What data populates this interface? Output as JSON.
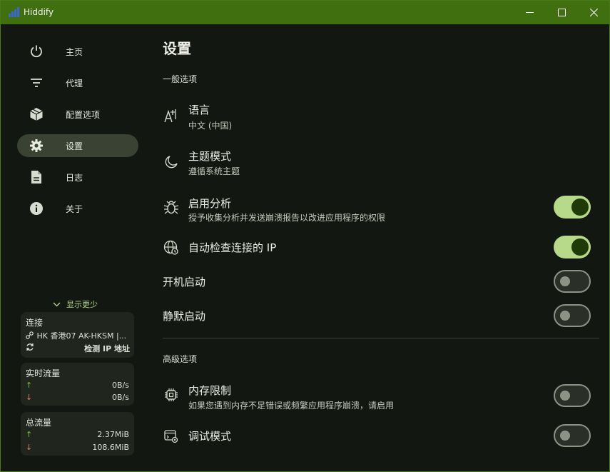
{
  "app": {
    "title": "Hiddify"
  },
  "window_controls": [
    "minimize-icon",
    "maximize-icon",
    "close-icon"
  ],
  "sidebar": {
    "items": [
      {
        "label": "主页",
        "icon": "power-icon",
        "active": false
      },
      {
        "label": "代理",
        "icon": "filter-icon",
        "active": false
      },
      {
        "label": "配置选项",
        "icon": "box-icon",
        "active": false
      },
      {
        "label": "设置",
        "icon": "gear-icon",
        "active": true
      },
      {
        "label": "日志",
        "icon": "document-icon",
        "active": false
      },
      {
        "label": "关于",
        "icon": "info-icon",
        "active": false
      }
    ],
    "show_less": "显示更少"
  },
  "connection": {
    "title": "连接",
    "server": "HK 香港07 AK-HKSM |...",
    "detect_ip": "检测 IP 地址"
  },
  "realtime": {
    "title": "实时流量",
    "up_arrow": "↑",
    "down_arrow": "↓",
    "up": "0B/s",
    "down": "0B/s"
  },
  "total": {
    "title": "总流量",
    "up_arrow": "↑",
    "down_arrow": "↓",
    "up": "2.37MiB",
    "down": "108.6MiB"
  },
  "settings": {
    "page_title": "设置",
    "general_title": "一般选项",
    "language": {
      "title": "语言",
      "value": "中文 (中国)"
    },
    "theme": {
      "title": "主题模式",
      "value": "遵循系统主题"
    },
    "analytics": {
      "title": "启用分析",
      "description": "授予收集分析并发送崩溃报告以改进应用程序的权限",
      "enabled": true
    },
    "auto_ip": {
      "title": "自动检查连接的 IP",
      "enabled": true
    },
    "autostart": {
      "title": "开机启动",
      "enabled": false
    },
    "silent": {
      "title": "静默启动",
      "enabled": false
    },
    "advanced_title": "高级选项",
    "memory": {
      "title": "内存限制",
      "description": "如果您遇到内存不足错误或频繁应用程序崩溃，请启用",
      "enabled": false
    },
    "debug": {
      "title": "调试模式",
      "enabled": false
    }
  },
  "colors": {
    "titlebar": "#3f6f0e",
    "background": "#131712",
    "accent": "#b6d98a",
    "toggle_knob_on": "#1f3a07"
  }
}
